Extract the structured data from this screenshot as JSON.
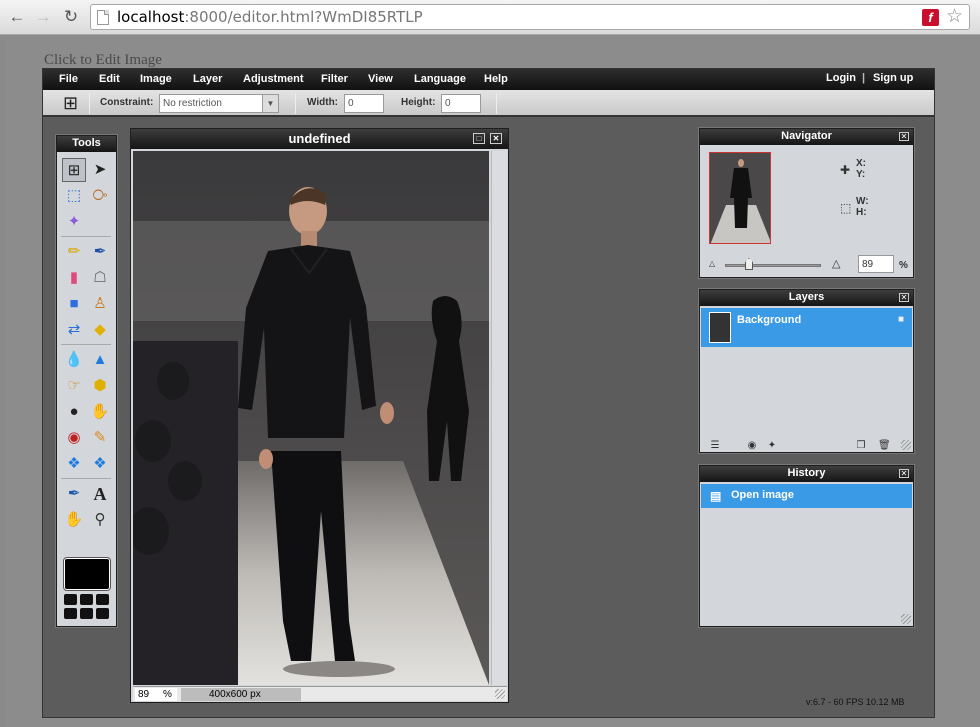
{
  "browser": {
    "url_host": "localhost",
    "url_rest": ":8000/editor.html?WmDI85RTLP",
    "back_icon": "arrow-left-icon",
    "forward_icon": "arrow-right-icon",
    "reload_icon": "reload-icon"
  },
  "page": {
    "click_to_edit": "Click to Edit Image"
  },
  "menu": {
    "items": [
      "File",
      "Edit",
      "Image",
      "Layer",
      "Adjustment",
      "Filter",
      "View",
      "Language",
      "Help"
    ],
    "login": "Login",
    "divider": "|",
    "signup": "Sign up"
  },
  "toolbar": {
    "constraint_label": "Constraint:",
    "constraint_value": "No restriction",
    "width_label": "Width:",
    "width_value": "0",
    "height_label": "Height:",
    "height_value": "0"
  },
  "tools_panel": {
    "title": "Tools"
  },
  "document": {
    "title": "undefined",
    "zoom": "89",
    "zoom_unit": "%",
    "dimensions": "400x600 px"
  },
  "navigator": {
    "title": "Navigator",
    "x_label": "X:",
    "y_label": "Y:",
    "w_label": "W:",
    "h_label": "H:",
    "zoom": "89",
    "zoom_unit": "%"
  },
  "layers": {
    "title": "Layers",
    "items": [
      {
        "name": "Background",
        "locked": true
      }
    ]
  },
  "history": {
    "title": "History",
    "items": [
      "Open image"
    ]
  },
  "status": {
    "version": "v:6.7 - 60 FPS 10.12 MB"
  },
  "colors": {
    "selection": "#3a9ae6",
    "panel_bg": "#d3d6da",
    "workspace": "#5c5c5c",
    "foreground_color": "#000000"
  }
}
